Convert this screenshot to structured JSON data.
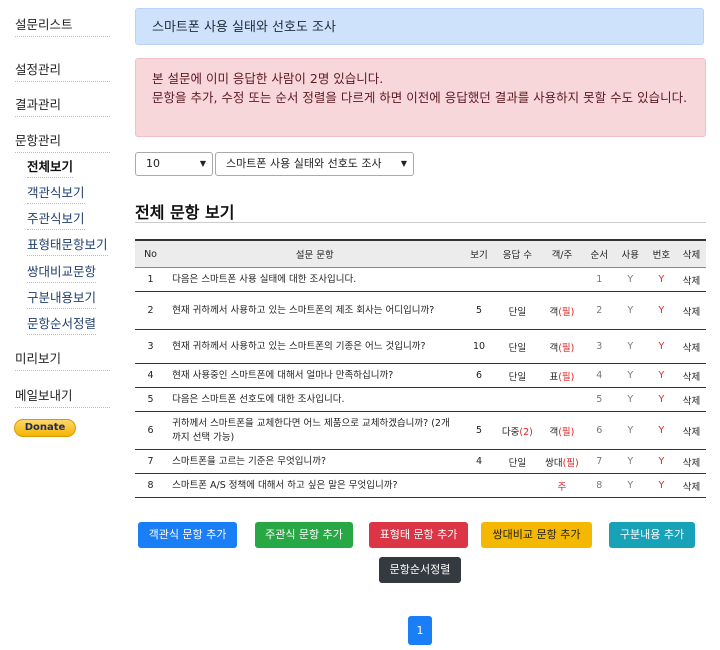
{
  "sidebar": {
    "survey_list": "설문리스트",
    "settings": "설정관리",
    "results": "결과관리",
    "questions": "문항관리",
    "sub_items": [
      "전체보기",
      "객관식보기",
      "주관식보기",
      "표형태문항보기",
      "쌍대비교문항",
      "구분내용보기",
      "문항순서정렬"
    ],
    "preview": "미리보기",
    "email": "메일보내기",
    "donate": "Donate"
  },
  "header": {
    "survey_title": "스마트폰 사용 실태와 선호도 조사"
  },
  "alert": {
    "line1": "본 설문에 이미 응답한 사람이 2명 있습니다.",
    "line2": "문항을 추가, 수정 또는 순서 정렬을 다르게 하면 이전에 응답했던 결과를 사용하지 못할 수도 있습니다."
  },
  "controls": {
    "page_size": "10",
    "survey_select": "스마트폰 사용 실태와 선호도 조사"
  },
  "section_title": "전체 문항 보기",
  "table": {
    "headers": [
      "No",
      "설문 문항",
      "보기",
      "응답 수",
      "객/주",
      "순서",
      "사용",
      "번호",
      "삭제"
    ],
    "rows": [
      {
        "no": "1",
        "q": "다음은 스마트폰 사용 실태에 대한 조사입니다.",
        "opts": "",
        "resp": "",
        "resp_extra": "",
        "type": "",
        "type_extra": "",
        "order": "1",
        "use": "Y",
        "num": "Y",
        "del": "삭제"
      },
      {
        "no": "2",
        "q": "현재 귀하께서 사용하고 있는 스마트폰의 제조 회사는 어디입니까?",
        "opts": "5",
        "resp": "단일",
        "resp_extra": "",
        "type": "객",
        "type_extra": "(필)",
        "order": "2",
        "use": "Y",
        "num": "Y",
        "del": "삭제"
      },
      {
        "no": "3",
        "q": "현재 귀하께서 사용하고 있는 스마트폰의 기종은 어느 것입니까?",
        "opts": "10",
        "resp": "단일",
        "resp_extra": "",
        "type": "객",
        "type_extra": "(필)",
        "order": "3",
        "use": "Y",
        "num": "Y",
        "del": "삭제"
      },
      {
        "no": "4",
        "q": "현재 사용중인 스마트폰에 대해서 얼마나 만족하십니까?",
        "opts": "6",
        "resp": "단일",
        "resp_extra": "",
        "type": "표",
        "type_extra": "(필)",
        "order": "4",
        "use": "Y",
        "num": "Y",
        "del": "삭제"
      },
      {
        "no": "5",
        "q": "다음은 스마트폰 선호도에 대한 조사입니다.",
        "opts": "",
        "resp": "",
        "resp_extra": "",
        "type": "",
        "type_extra": "",
        "order": "5",
        "use": "Y",
        "num": "Y",
        "del": "삭제"
      },
      {
        "no": "6",
        "q": "귀하께서 스마트폰을 교체한다면 어느 제품으로 교체하겠습니까? (2개까지 선택 가능)",
        "opts": "5",
        "resp": "다중",
        "resp_extra": "(2)",
        "type": "객",
        "type_extra": "(필)",
        "order": "6",
        "use": "Y",
        "num": "Y",
        "del": "삭제"
      },
      {
        "no": "7",
        "q": "스마트폰을 고르는 기준은 무엇입니까?",
        "opts": "4",
        "resp": "단일",
        "resp_extra": "",
        "type": "쌍대",
        "type_extra": "(필)",
        "order": "7",
        "use": "Y",
        "num": "Y",
        "del": "삭제"
      },
      {
        "no": "8",
        "q": "스마트폰 A/S 정책에 대해서 하고 싶은 말은 무엇입니까?",
        "opts": "",
        "resp": "",
        "resp_extra": "",
        "type": "",
        "type_extra": "주",
        "order": "8",
        "use": "Y",
        "num": "Y",
        "del": "삭제"
      }
    ]
  },
  "buttons": {
    "add_objective": "객관식 문항 추가",
    "add_subjective": "주관식 문항 추가",
    "add_table": "표형태 문항 추가",
    "add_pair": "쌍대비교 문항 추가",
    "add_section": "구분내용 추가",
    "sort_order": "문항순서정렬"
  },
  "colors": {
    "blue": "#1a7ef7",
    "green": "#28a745",
    "red": "#dc3545",
    "yellow": "#f5b800",
    "teal": "#17a2b8",
    "dark": "#343a40"
  },
  "pagination": {
    "current": "1"
  }
}
